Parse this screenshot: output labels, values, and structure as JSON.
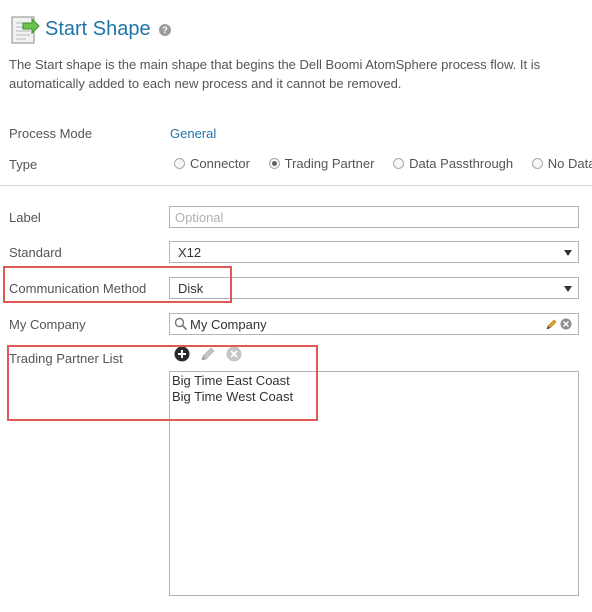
{
  "header": {
    "title": "Start Shape",
    "help_glyph": "?",
    "description": "The Start shape is the main shape that begins the Dell Boomi AtomSphere process flow. It is automatically added to each new process and it cannot be removed."
  },
  "process_mode": {
    "label": "Process Mode",
    "value": "General"
  },
  "type": {
    "label": "Type",
    "options": [
      {
        "label": "Connector",
        "selected": false
      },
      {
        "label": "Trading Partner",
        "selected": true
      },
      {
        "label": "Data Passthrough",
        "selected": false
      },
      {
        "label": "No Data",
        "selected": false
      }
    ]
  },
  "label_field": {
    "label": "Label",
    "placeholder": "Optional",
    "value": ""
  },
  "standard": {
    "label": "Standard",
    "value": "X12"
  },
  "communication_method": {
    "label": "Communication Method",
    "value": "Disk"
  },
  "my_company": {
    "label": "My Company",
    "value": "My Company"
  },
  "trading_partner_list": {
    "label": "Trading Partner List",
    "items": [
      "Big Time East Coast",
      "Big Time West Coast"
    ]
  },
  "icons": {
    "shape": "start-shape-icon",
    "help": "help-icon",
    "search": "search-icon",
    "edit": "pencil-icon",
    "clear": "clear-icon",
    "add": "add-icon",
    "remove": "remove-icon",
    "dropdown": "chevron-down-icon"
  },
  "colors": {
    "accent": "#1f74a8",
    "highlight": "#e05a55",
    "text": "#555555"
  }
}
